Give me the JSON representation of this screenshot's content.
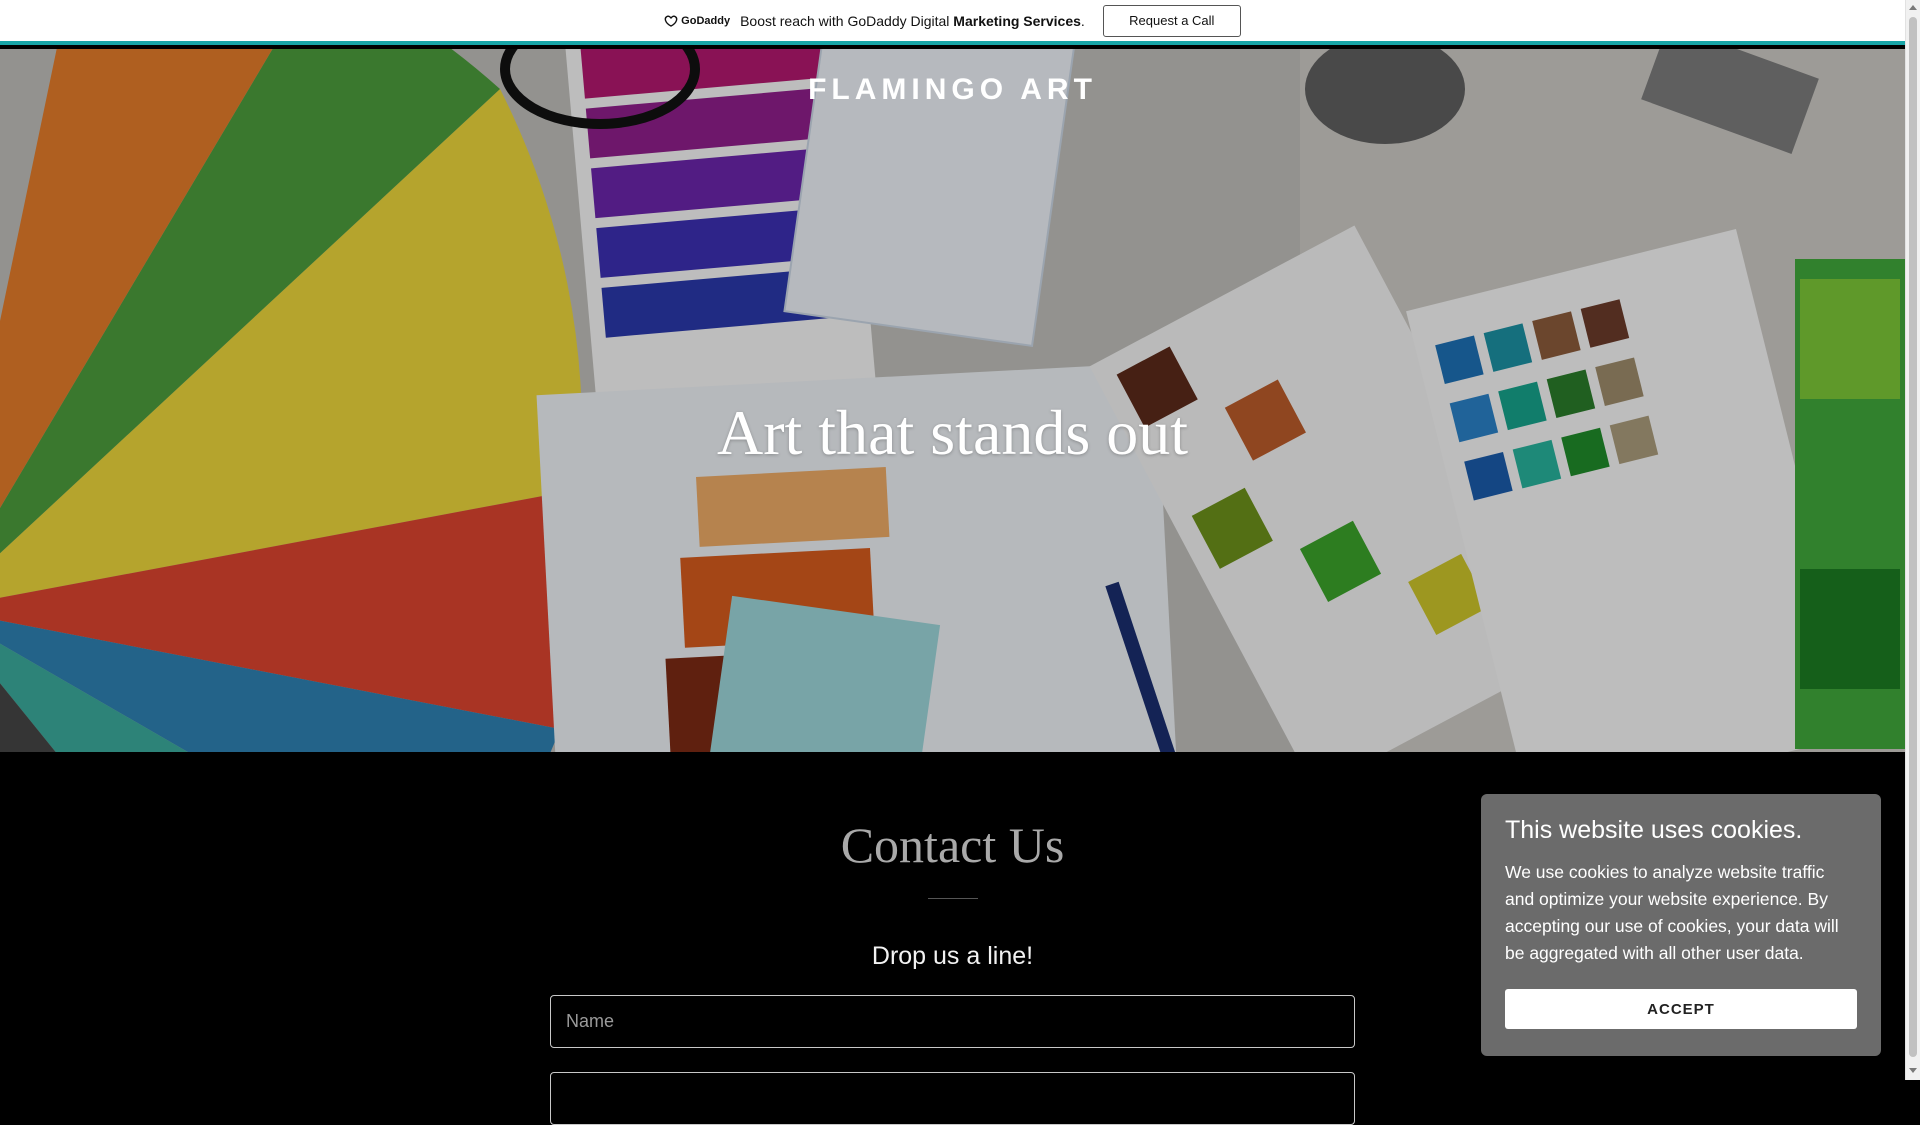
{
  "promo": {
    "logo_text": "GoDaddy",
    "text_before": "Boost reach with GoDaddy Digital ",
    "text_bold": "Marketing Services",
    "text_after": ".",
    "button_label": "Request a Call",
    "accent_color": "#18a5a7"
  },
  "hero": {
    "site_title": "FLAMINGO ART",
    "tagline": "Art that stands out"
  },
  "contact": {
    "title": "Contact Us",
    "subtitle": "Drop us a line!",
    "name_placeholder": "Name"
  },
  "cookie": {
    "title": "This website uses cookies.",
    "text": "We use cookies to analyze website traffic and optimize your website experience. By accepting our use of cookies, your data will be aggregated with all other user data.",
    "accept_label": "ACCEPT"
  }
}
